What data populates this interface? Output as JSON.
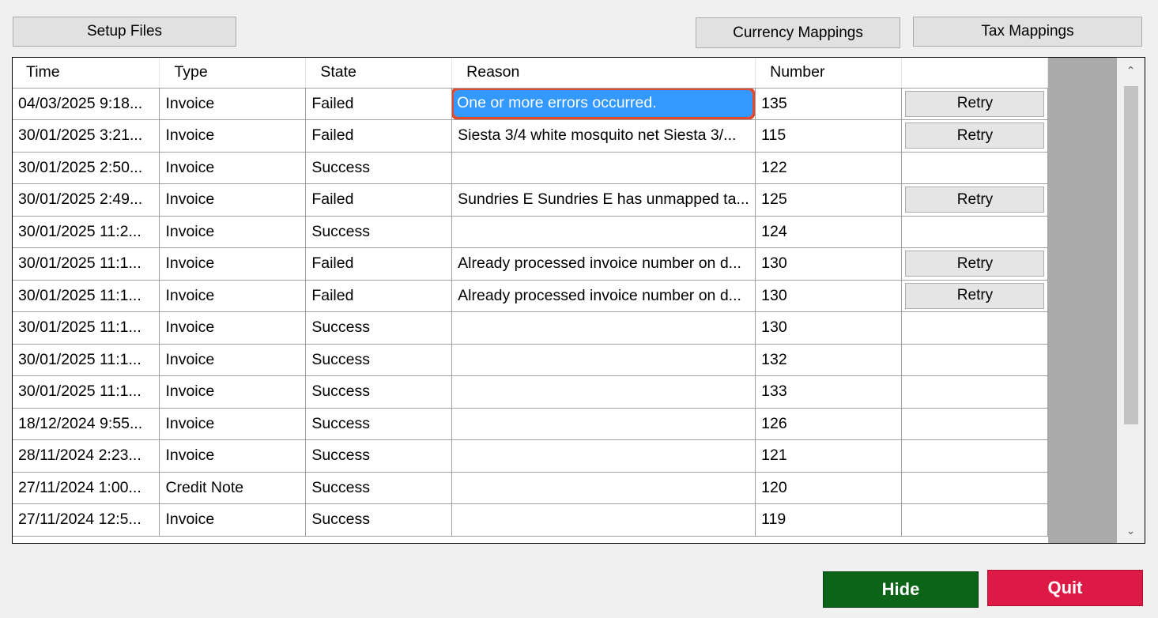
{
  "toolbar": {
    "setup_files": "Setup Files",
    "currency_mappings": "Currency Mappings",
    "tax_mappings": "Tax Mappings"
  },
  "grid": {
    "columns": [
      "Time",
      "Type",
      "State",
      "Reason",
      "Number",
      ""
    ],
    "retry_label": "Retry",
    "selected_row": 0,
    "rows": [
      {
        "time": "04/03/2025 9:18...",
        "type": "Invoice",
        "state": "Failed",
        "reason": "One or more errors occurred.",
        "number": "135",
        "retry": true
      },
      {
        "time": "30/01/2025 3:21...",
        "type": "Invoice",
        "state": "Failed",
        "reason": "Siesta 3/4 white mosquito net Siesta 3/...",
        "number": "115",
        "retry": true
      },
      {
        "time": "30/01/2025 2:50...",
        "type": "Invoice",
        "state": "Success",
        "reason": "",
        "number": "122",
        "retry": false
      },
      {
        "time": "30/01/2025 2:49...",
        "type": "Invoice",
        "state": "Failed",
        "reason": "Sundries E Sundries E has unmapped ta...",
        "number": "125",
        "retry": true
      },
      {
        "time": "30/01/2025 11:2...",
        "type": "Invoice",
        "state": "Success",
        "reason": "",
        "number": "124",
        "retry": false
      },
      {
        "time": "30/01/2025 11:1...",
        "type": "Invoice",
        "state": "Failed",
        "reason": "Already processed invoice number on d...",
        "number": "130",
        "retry": true
      },
      {
        "time": "30/01/2025 11:1...",
        "type": "Invoice",
        "state": "Failed",
        "reason": "Already processed invoice number on d...",
        "number": "130",
        "retry": true
      },
      {
        "time": "30/01/2025 11:1...",
        "type": "Invoice",
        "state": "Success",
        "reason": "",
        "number": "130",
        "retry": false
      },
      {
        "time": "30/01/2025 11:1...",
        "type": "Invoice",
        "state": "Success",
        "reason": "",
        "number": "132",
        "retry": false
      },
      {
        "time": "30/01/2025 11:1...",
        "type": "Invoice",
        "state": "Success",
        "reason": "",
        "number": "133",
        "retry": false
      },
      {
        "time": "18/12/2024 9:55...",
        "type": "Invoice",
        "state": "Success",
        "reason": "",
        "number": "126",
        "retry": false
      },
      {
        "time": "28/11/2024 2:23...",
        "type": "Invoice",
        "state": "Success",
        "reason": "",
        "number": "121",
        "retry": false
      },
      {
        "time": "27/11/2024 1:00...",
        "type": "Credit Note",
        "state": "Success",
        "reason": "",
        "number": "120",
        "retry": false
      },
      {
        "time": "27/11/2024 12:5...",
        "type": "Invoice",
        "state": "Success",
        "reason": "",
        "number": "119",
        "retry": false
      }
    ]
  },
  "scrollbar": {
    "up_icon": "chevron-up-icon",
    "down_icon": "chevron-down-icon"
  },
  "footer": {
    "hide": "Hide",
    "quit": "Quit",
    "hide_color": "#0b6417",
    "quit_color": "#dd1a45"
  },
  "colors": {
    "selection": "#3399ff",
    "highlight_outline": "#e0492e"
  }
}
